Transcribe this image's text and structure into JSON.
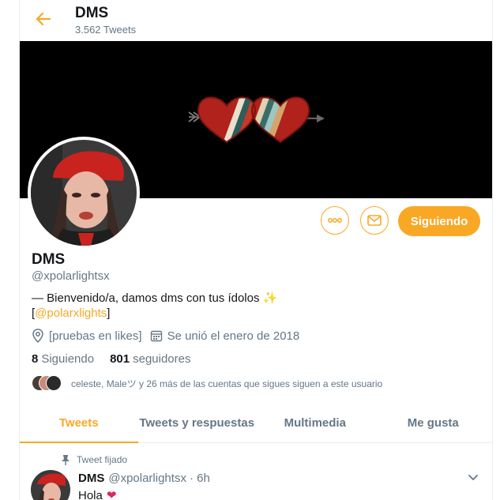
{
  "header": {
    "title": "DMS",
    "tweet_count": "3.562 Tweets"
  },
  "profile": {
    "name": "DMS",
    "handle": "@xpolarlightsx",
    "bio_line1": "— Bienvenido/a, damos dms con tus ídolos",
    "bio_emoji": "✨",
    "bio_line2_open": "[",
    "bio_link": "@polarxlights",
    "bio_line2_close": "]",
    "location": "[pruebas en likes]",
    "joined": "Se unió el enero de 2018",
    "following_count": "8",
    "following_label": "Siguiendo",
    "followers_count": "801",
    "followers_label": "seguidores",
    "followers_you_know": "celeste, Maleツ y 26 más de las cuentas que sigues siguen a este usuario"
  },
  "actions": {
    "follow_label": "Siguiendo"
  },
  "tabs": [
    {
      "label": "Tweets",
      "active": true
    },
    {
      "label": "Tweets y respuestas",
      "active": false
    },
    {
      "label": "Multimedia",
      "active": false
    },
    {
      "label": "Me gusta",
      "active": false
    }
  ],
  "pinned_tweet": {
    "pinned_label": "Tweet fijado",
    "name": "DMS",
    "handle": "@xpolarlightsx",
    "time": "· 6h",
    "text": "Hola",
    "emoji": "❤"
  },
  "colors": {
    "accent": "#f9a825",
    "text_primary": "#14171a",
    "text_secondary": "#657786",
    "banner_bg": "#000000",
    "heart": "#e0245e"
  },
  "icons": [
    "arrow-left-icon",
    "more-icon",
    "mail-icon",
    "location-icon",
    "calendar-icon",
    "pin-icon",
    "chevron-down-icon"
  ]
}
